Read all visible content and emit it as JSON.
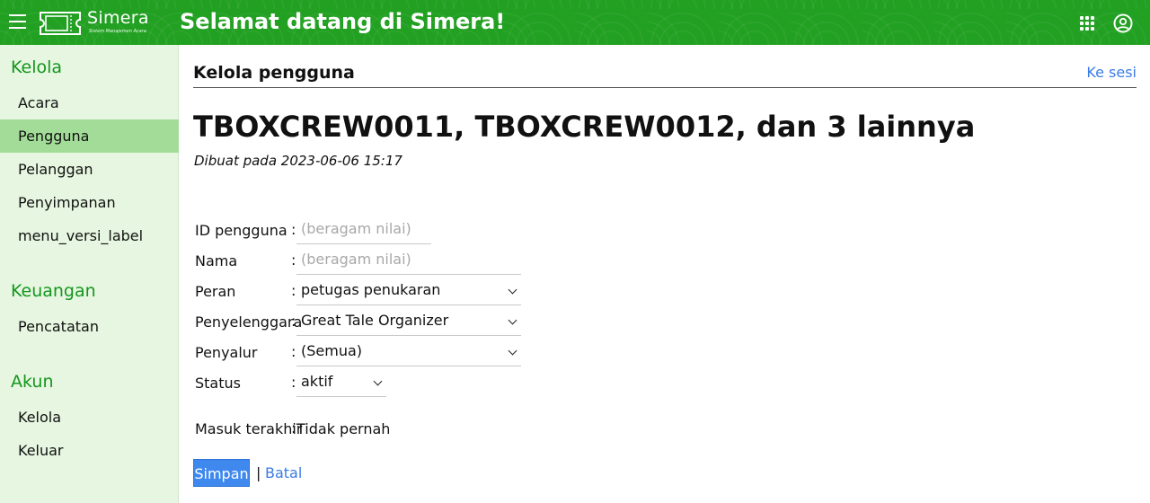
{
  "header": {
    "brand_name": "Simera",
    "brand_tagline": "Sistem Manajemen Acara",
    "welcome": "Selamat datang di Simera!",
    "menu_icon": "hamburger-icon",
    "apps_icon": "apps-grid-icon",
    "account_icon": "account-circle-icon",
    "color": "#22a022"
  },
  "sidebar": {
    "sections": [
      {
        "title": "Kelola",
        "items": [
          "Acara",
          "Pengguna",
          "Pelanggan",
          "Penyimpanan",
          "menu_versi_label"
        ]
      },
      {
        "title": "Keuangan",
        "items": [
          "Pencatatan"
        ]
      },
      {
        "title": "Akun",
        "items": [
          "Kelola",
          "Keluar"
        ]
      }
    ],
    "active_item": "Pengguna",
    "active_color": "#a3dc98",
    "accent_color": "#14961e"
  },
  "main": {
    "section_title": "Kelola pengguna",
    "to_session_link": "Ke sesi",
    "page_title": "TBOXCREW0011, TBOXCREW0012, dan 3 lainnya",
    "created_at": "Dibuat pada 2023-06-06 15:17",
    "form": {
      "user_id": {
        "label": "ID pengguna",
        "placeholder": "(beragam nilai)"
      },
      "name": {
        "label": "Nama",
        "placeholder": "(beragam nilai)"
      },
      "role": {
        "label": "Peran",
        "value": "petugas penukaran"
      },
      "organizer": {
        "label": "Penyelenggara",
        "value": "Great Tale Organizer"
      },
      "distributor": {
        "label": "Penyalur",
        "value": "(Semua)"
      },
      "status": {
        "label": "Status",
        "value": "aktif"
      },
      "last_login": {
        "label": "Masuk terakhir",
        "value": "Tidak pernah"
      },
      "colon": ":"
    },
    "actions": {
      "save": "Simpan",
      "separator": "|",
      "cancel": "Batal"
    },
    "link_color": "#3a7be6"
  }
}
